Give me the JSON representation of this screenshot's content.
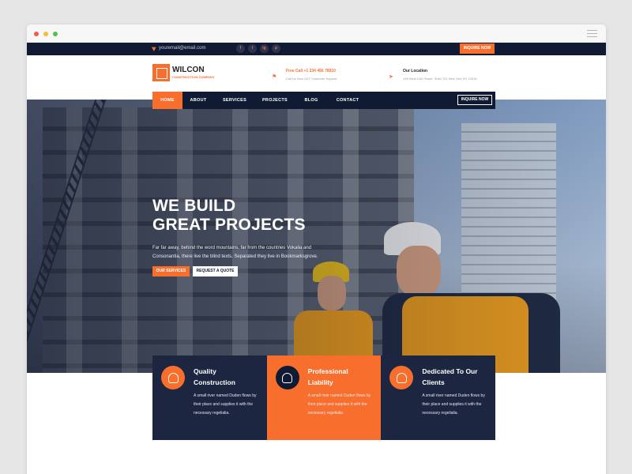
{
  "topbar": {
    "email": "youremail@email.com",
    "socials": [
      "f",
      "t",
      "ig",
      "p"
    ],
    "inquire_label": "INQUIRE NOW"
  },
  "brand": {
    "name": "WILCON",
    "tagline": "CONSTRUCTION COMPANY"
  },
  "contacts": [
    {
      "icon": "flag-icon",
      "title": "Free Call +1 234 456 78910",
      "sub": "Call Us Now 24/7 Customer Support"
    },
    {
      "icon": "location-icon",
      "title": "Our Location",
      "sub": "198 West 21th Street, Suite 721 New York NY 10016"
    }
  ],
  "nav": {
    "items": [
      "HOME",
      "ABOUT",
      "SERVICES",
      "PROJECTS",
      "BLOG",
      "CONTACT"
    ],
    "active": "HOME",
    "inquire_label": "INQUIRE NOW"
  },
  "hero": {
    "title_line1": "WE BUILD",
    "title_line2": "GREAT PROJECTS",
    "description": "Far far away, behind the word mountains, far from the countries Vokalia and Consonantia, there live the blind texts. Separated they live in Bookmarksgrove.",
    "primary_button": "OUR SERVICES",
    "secondary_button": "REQUEST A QUOTE"
  },
  "features": [
    {
      "icon": "construction-icon",
      "title_line1": "Quality",
      "title_line2": "Construction",
      "text": "A small river named Duden flows by their place and supplies it with the necessary regelialia."
    },
    {
      "icon": "worker-icon",
      "title_line1": "Professional",
      "title_line2": "Liability",
      "text": "A small river named Duden flows by their place and supplies it with the necessary regelialia."
    },
    {
      "icon": "clients-icon",
      "title_line1": "Dedicated To Our",
      "title_line2": "Clients",
      "text": "A small river named Duden flows by their place and supplies it with the necessary regelialia."
    }
  ],
  "colors": {
    "accent": "#f86f2d",
    "navy": "#111a33",
    "card_navy": "#1d2641"
  }
}
